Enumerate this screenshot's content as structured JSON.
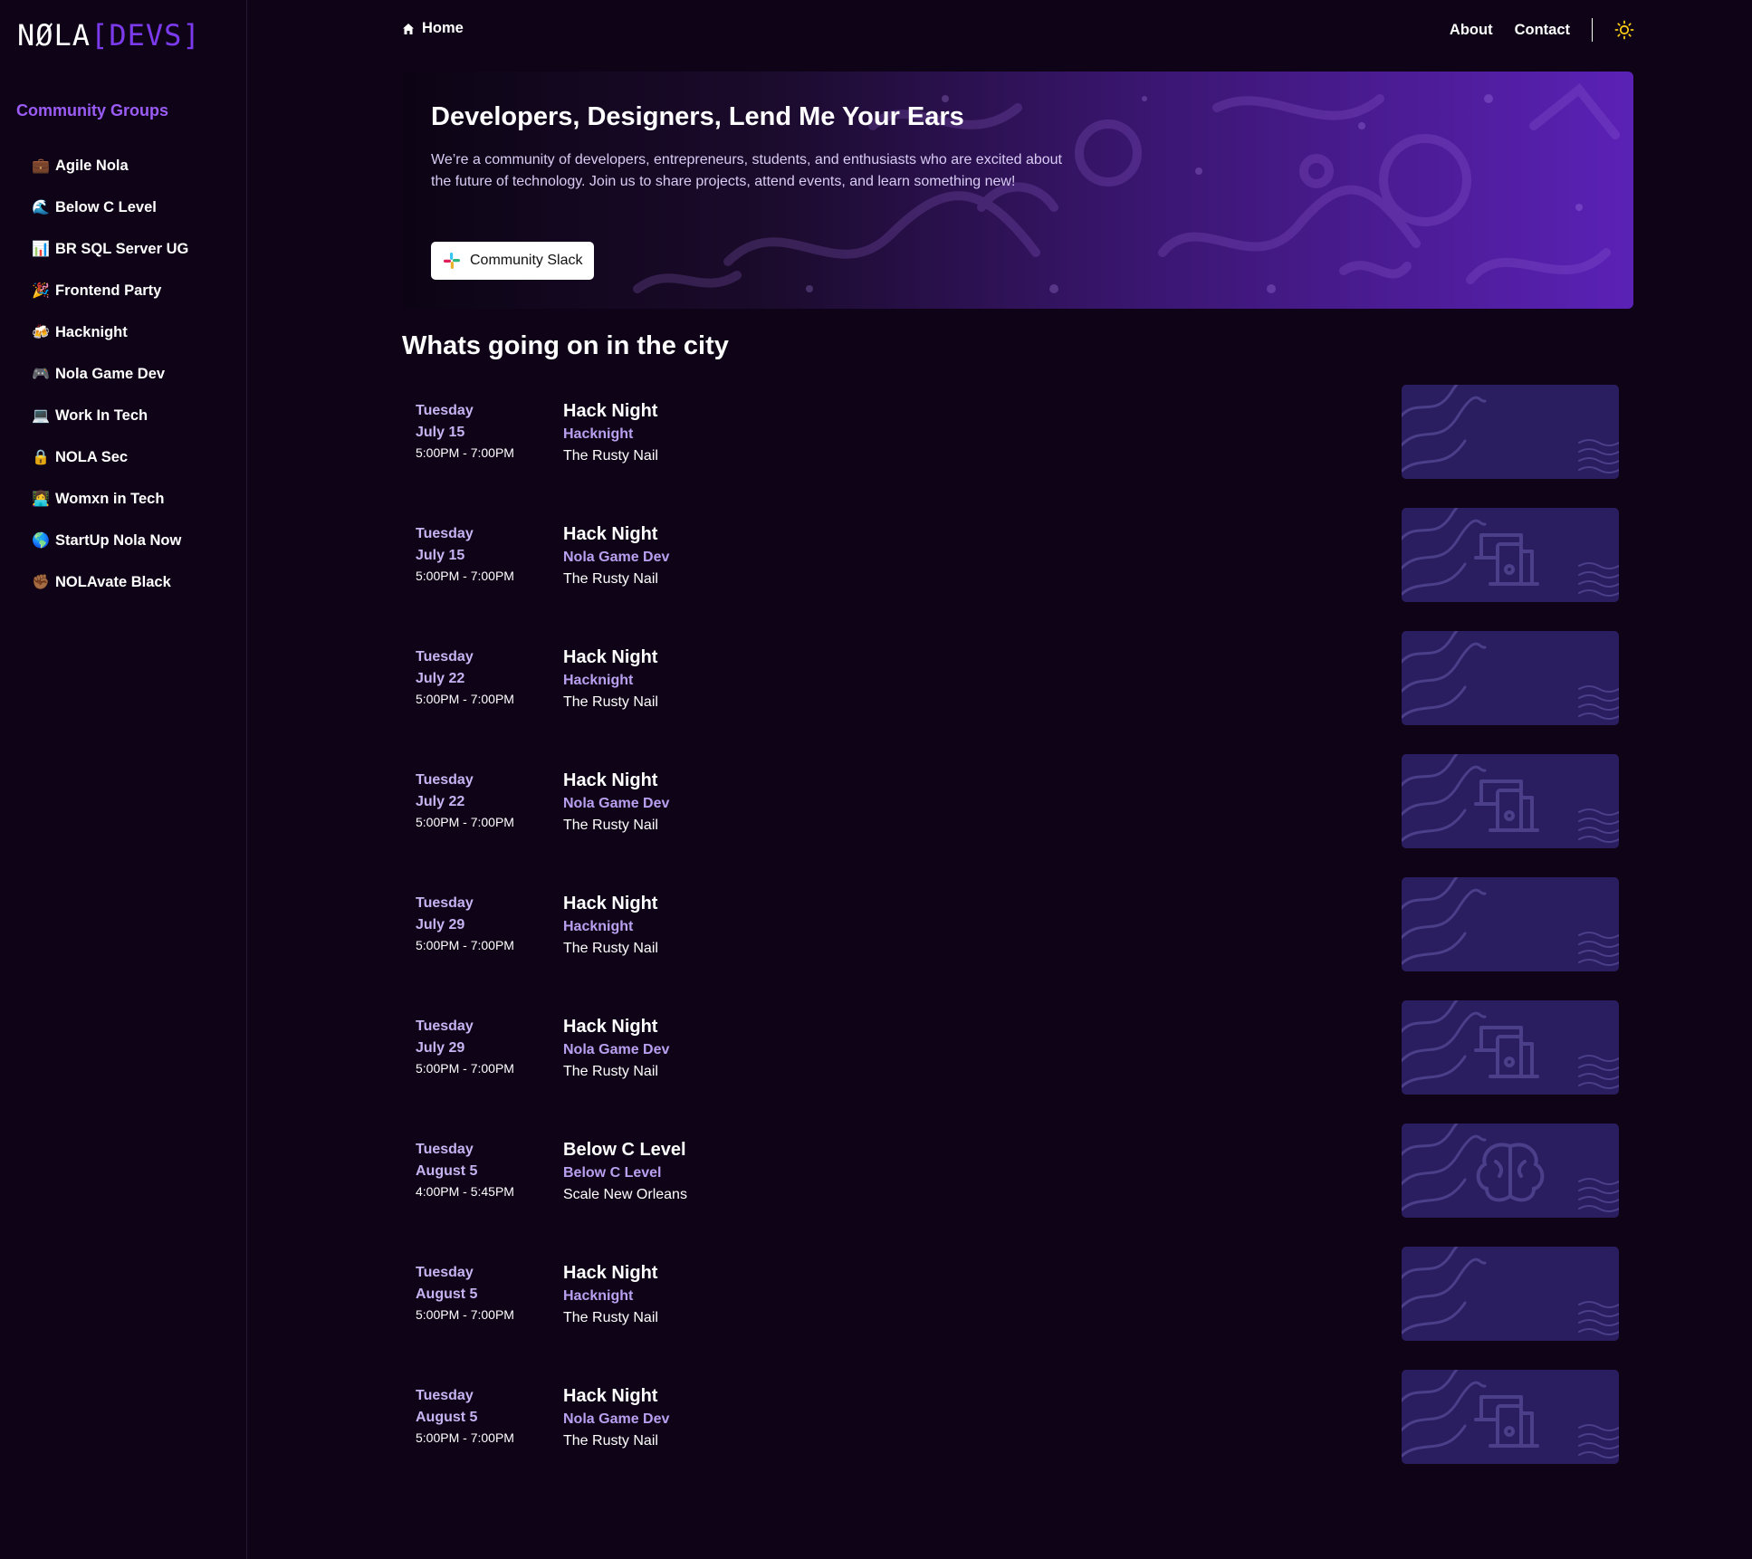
{
  "logo": {
    "part1": "NØLA",
    "part2": "[DEVS]"
  },
  "sidebar": {
    "heading": "Community Groups",
    "groups": [
      {
        "emoji": "💼",
        "label": "Agile Nola"
      },
      {
        "emoji": "🌊",
        "label": "Below C Level"
      },
      {
        "emoji": "📊",
        "label": "BR SQL Server UG"
      },
      {
        "emoji": "🎉",
        "label": "Frontend Party"
      },
      {
        "emoji": "🍻",
        "label": "Hacknight"
      },
      {
        "emoji": "🎮",
        "label": "Nola Game Dev"
      },
      {
        "emoji": "💻",
        "label": "Work In Tech"
      },
      {
        "emoji": "🔒",
        "label": "NOLA Sec"
      },
      {
        "emoji": "👩‍💻",
        "label": "Womxn in Tech"
      },
      {
        "emoji": "🌎",
        "label": "StartUp Nola Now"
      },
      {
        "emoji": "✊🏾",
        "label": "NOLAvate Black"
      }
    ]
  },
  "nav": {
    "home": "Home",
    "about": "About",
    "contact": "Contact",
    "theme_icon": "sun-icon"
  },
  "hero": {
    "title": "Developers, Designers, Lend Me Your Ears",
    "description": "We’re a community of developers, entrepreneurs, students, and enthusiasts who are excited about the future of technology. Join us to share projects, attend events, and learn something new!",
    "button": "Community Slack"
  },
  "section_title": "Whats going on in the city",
  "events": [
    {
      "day": "Tuesday",
      "date": "July 15",
      "time": "5:00PM - 7:00PM",
      "title": "Hack Night",
      "group": "Hacknight",
      "venue": "The Rusty Nail",
      "icon": "none"
    },
    {
      "day": "Tuesday",
      "date": "July 15",
      "time": "5:00PM - 7:00PM",
      "title": "Hack Night",
      "group": "Nola Game Dev",
      "venue": "The Rusty Nail",
      "icon": "devices"
    },
    {
      "day": "Tuesday",
      "date": "July 22",
      "time": "5:00PM - 7:00PM",
      "title": "Hack Night",
      "group": "Hacknight",
      "venue": "The Rusty Nail",
      "icon": "none"
    },
    {
      "day": "Tuesday",
      "date": "July 22",
      "time": "5:00PM - 7:00PM",
      "title": "Hack Night",
      "group": "Nola Game Dev",
      "venue": "The Rusty Nail",
      "icon": "devices"
    },
    {
      "day": "Tuesday",
      "date": "July 29",
      "time": "5:00PM - 7:00PM",
      "title": "Hack Night",
      "group": "Hacknight",
      "venue": "The Rusty Nail",
      "icon": "none"
    },
    {
      "day": "Tuesday",
      "date": "July 29",
      "time": "5:00PM - 7:00PM",
      "title": "Hack Night",
      "group": "Nola Game Dev",
      "venue": "The Rusty Nail",
      "icon": "devices"
    },
    {
      "day": "Tuesday",
      "date": "August 5",
      "time": "4:00PM - 5:45PM",
      "title": "Below C Level",
      "group": "Below C Level",
      "venue": "Scale New Orleans",
      "icon": "brain"
    },
    {
      "day": "Tuesday",
      "date": "August 5",
      "time": "5:00PM - 7:00PM",
      "title": "Hack Night",
      "group": "Hacknight",
      "venue": "The Rusty Nail",
      "icon": "none"
    },
    {
      "day": "Tuesday",
      "date": "August 5",
      "time": "5:00PM - 7:00PM",
      "title": "Hack Night",
      "group": "Nola Game Dev",
      "venue": "The Rusty Nail",
      "icon": "devices"
    }
  ],
  "colors": {
    "background": "#0f0417",
    "accent": "#7c3aed",
    "thumb": "#2a1e60"
  }
}
